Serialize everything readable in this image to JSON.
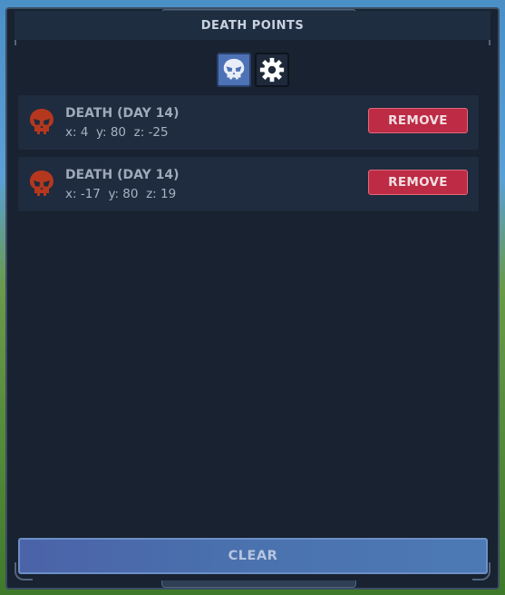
{
  "panel": {
    "title": "DEATH POINTS"
  },
  "tabs": [
    {
      "icon": "skull-icon",
      "active": true
    },
    {
      "icon": "gear-icon",
      "active": false
    }
  ],
  "death_points": [
    {
      "title": "DEATH (DAY 14)",
      "coords": "x: 4  y: 80  z: -25",
      "remove_label": "REMOVE"
    },
    {
      "title": "DEATH (DAY 14)",
      "coords": "x: -17  y: 80  z: 19",
      "remove_label": "REMOVE"
    }
  ],
  "footer": {
    "clear_label": "CLEAR"
  },
  "colors": {
    "panel_bg": "#182230",
    "row_bg": "#1f2b3e",
    "remove_bg": "#bd2b44",
    "active_tab": "#4d72b6",
    "skull_red": "#b5381e"
  }
}
